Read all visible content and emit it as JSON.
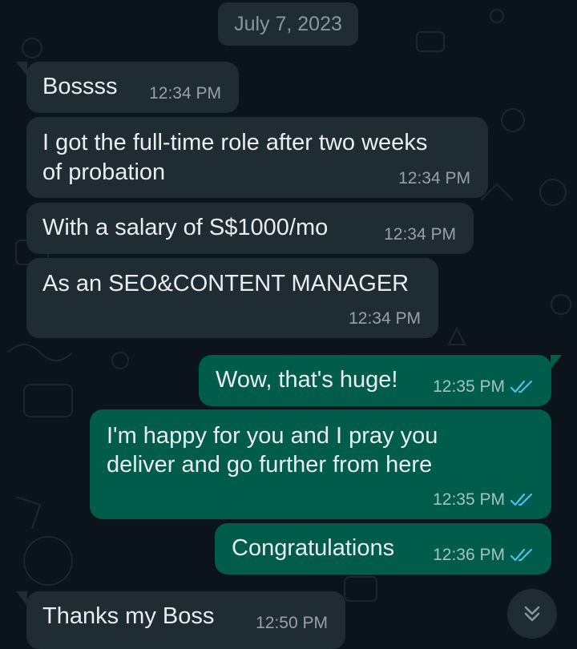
{
  "date_divider": "July 7, 2023",
  "colors": {
    "background": "#0b141a",
    "incoming_bubble": "#202c33",
    "outgoing_bubble": "#005c4b",
    "read_receipt": "#53bdeb"
  },
  "messages": [
    {
      "direction": "incoming",
      "text": "Bossss",
      "time": "12:34 PM"
    },
    {
      "direction": "incoming",
      "lines": [
        "I got the full-time role after two weeks",
        "of probation"
      ],
      "time": "12:34 PM"
    },
    {
      "direction": "incoming",
      "text": "With a salary of S$1000/mo",
      "time": "12:34 PM"
    },
    {
      "direction": "incoming",
      "text": "As an SEO&CONTENT MANAGER",
      "time": "12:34 PM"
    },
    {
      "direction": "outgoing",
      "text": "Wow, that's huge!",
      "time": "12:35 PM",
      "status_icon": "double-check-read-icon"
    },
    {
      "direction": "outgoing",
      "lines": [
        "I'm happy for you and I pray you",
        "deliver and go further from here"
      ],
      "time": "12:35 PM",
      "status_icon": "double-check-read-icon"
    },
    {
      "direction": "outgoing",
      "text": "Congratulations",
      "time": "12:36 PM",
      "status_icon": "double-check-read-icon"
    },
    {
      "direction": "incoming",
      "text": "Thanks my Boss",
      "time": "12:50 PM"
    }
  ],
  "scroll_button": {
    "icon": "chevron-double-down-icon"
  }
}
